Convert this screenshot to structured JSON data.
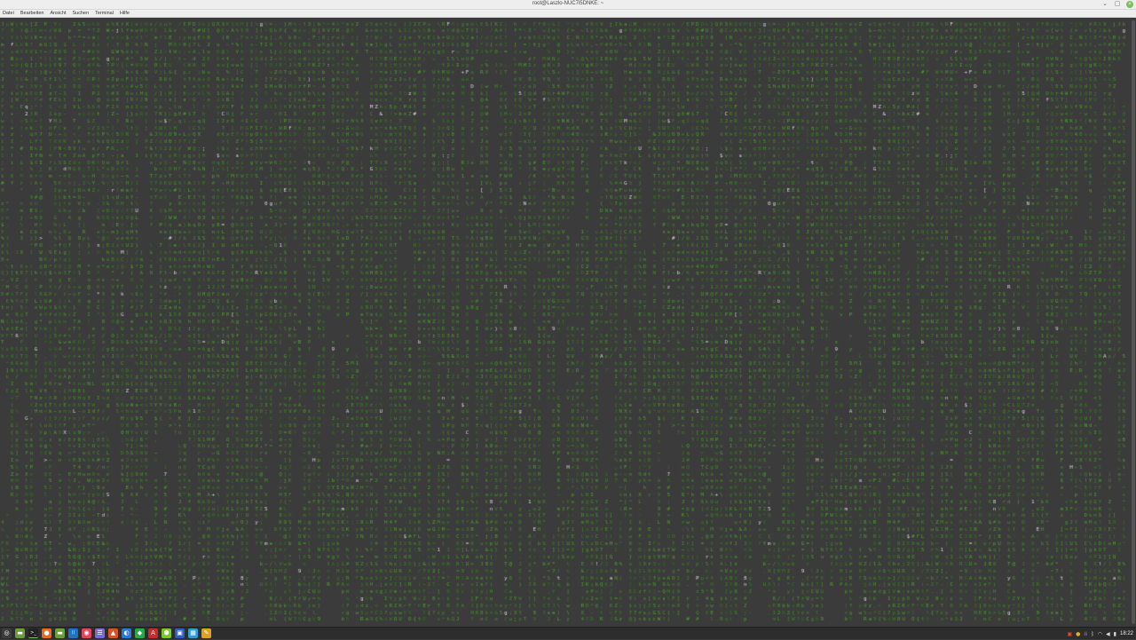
{
  "window": {
    "title": "root@Laszlo-NUC7i5DNKE: ~",
    "controls": {
      "minimize": "⌄",
      "maximize": "▢",
      "close": "×"
    }
  },
  "menu": {
    "items": [
      "Datei",
      "Bearbeiten",
      "Ansicht",
      "Suchen",
      "Terminal",
      "Hilfe"
    ]
  },
  "terminal": {
    "background": "#3b3b3b",
    "rain_color": "#4f9a2c",
    "highlight_color": "#d8d8d8",
    "charset": "abcdefghijklmnopqrstuvwxyzABCDEFGHIJKLMNOPQRSTUVWXYZ0123456789&%$#@<>!?/\\|[]{}()+-=*^~;:,."
  },
  "taskbar": {
    "apps": [
      {
        "name": "menu-icon",
        "glyph": "◎",
        "color": "#3d3d3d"
      },
      {
        "name": "files-icon",
        "glyph": "▬",
        "color": "#6a9e3c"
      },
      {
        "name": "terminal-icon",
        "glyph": ">_",
        "color": "#222222"
      },
      {
        "name": "firefox-icon",
        "glyph": "●",
        "color": "#e86a1f"
      },
      {
        "name": "folder-icon",
        "glyph": "▬",
        "color": "#6aa03a"
      },
      {
        "name": "vscode-icon",
        "glyph": "⟨⟩",
        "color": "#1e73c2"
      },
      {
        "name": "record-icon",
        "glyph": "◉",
        "color": "#d94a5a"
      },
      {
        "name": "notes-icon",
        "glyph": "☰",
        "color": "#7a6ad9"
      },
      {
        "name": "brave-icon",
        "glyph": "▲",
        "color": "#d9532a"
      },
      {
        "name": "edge-icon",
        "glyph": "◐",
        "color": "#2a78d9"
      },
      {
        "name": "vpn-icon",
        "glyph": "◆",
        "color": "#2aa84a"
      },
      {
        "name": "pdf-icon",
        "glyph": "A",
        "color": "#c92a2a"
      },
      {
        "name": "cube-icon",
        "glyph": "⬢",
        "color": "#7ac92a"
      },
      {
        "name": "virtualbox-icon",
        "glyph": "▣",
        "color": "#2a5ec9"
      },
      {
        "name": "photo-icon",
        "glyph": "▦",
        "color": "#2a9ed9"
      },
      {
        "name": "paint-icon",
        "glyph": "✎",
        "color": "#e0a020"
      }
    ],
    "tray": [
      {
        "name": "alert-icon",
        "glyph": "▣",
        "color": "#e04a2a"
      },
      {
        "name": "update-icon",
        "glyph": "●",
        "color": "#e0b020"
      },
      {
        "name": "network-activity-icon",
        "glyph": "⁞⁞",
        "color": "#bbbbbb"
      },
      {
        "name": "bluetooth-icon",
        "glyph": "ᛒ",
        "color": "#dddddd"
      },
      {
        "name": "wifi-icon",
        "glyph": "◠",
        "color": "#dddddd"
      },
      {
        "name": "volume-icon",
        "glyph": "◀",
        "color": "#dddddd"
      },
      {
        "name": "battery-icon",
        "glyph": "▮",
        "color": "#dddddd"
      }
    ],
    "clock": "18:22"
  }
}
